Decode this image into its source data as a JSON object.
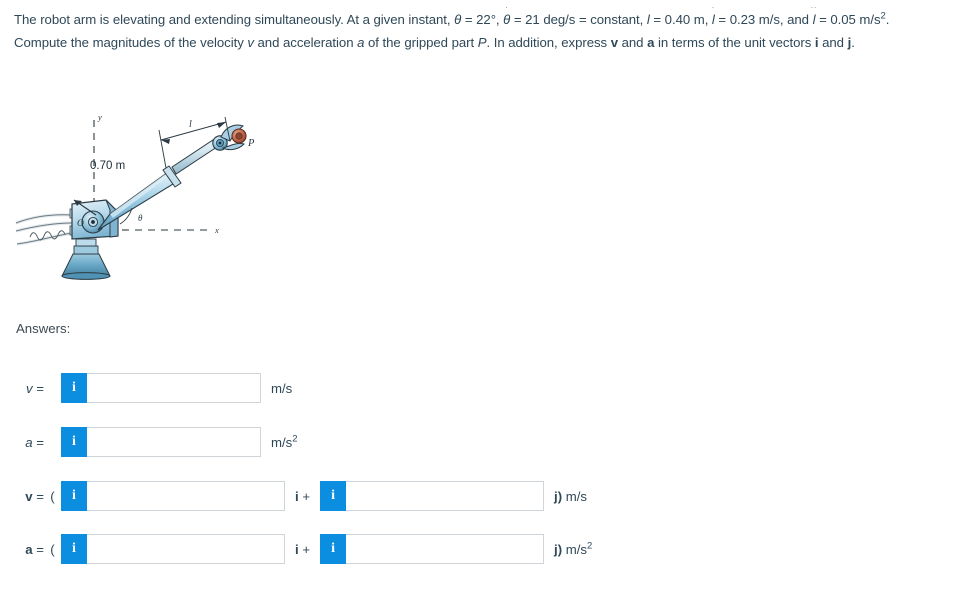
{
  "problem": {
    "line1_a": "The robot arm is elevating and extending simultaneously. At a given instant, ",
    "theta_sym": "θ",
    "eq_22": " = 22°, ",
    "thetadot_base": "θ",
    "thetadot_accent": "˙",
    "eq_21": " = 21 deg/s = constant, ",
    "l_sym": "l",
    "eq_l": " = 0.40 m, ",
    "ldot_base": "l",
    "ldot_accent": "˙",
    "eq_ldot": " = 0.23 m/s, and ",
    "lddot_base": "l",
    "lddot_accent": "˙˙",
    "eq_lddot": " = 0.05 m/s",
    "lddot_exp": "2",
    "line2_tail": ". Compute the magnitudes of the velocity ",
    "v_it": "v",
    "and_accel": " and acceleration ",
    "a_it": "a",
    "of_gripped": " of the gripped part ",
    "P_it": "P",
    "in_addition": ". In addition, express ",
    "v_bold": "v",
    "and_txt": " and ",
    "a_bold": "a",
    "in_terms": " in terms of the unit vectors ",
    "i_bold": "i",
    "and_txt2": " and ",
    "j_bold": "j",
    "period": "."
  },
  "figure": {
    "dimension_label": "0.70 m",
    "length_label": "l",
    "angle_label": "θ",
    "origin_label": "O",
    "point_label": "P",
    "x_axis_label": "x",
    "y_axis_label": "y",
    "colors": {
      "arm_light": "#cfe4f0",
      "arm_mid": "#8fc2dd",
      "arm_dark": "#5a9cc0",
      "base_dark": "#4f92b4",
      "part_red": "#c0654a",
      "outline": "#2b3a42"
    }
  },
  "answers": {
    "heading": "Answers:",
    "rows": [
      {
        "name": "velocity-magnitude",
        "label": "v",
        "label_bold": false,
        "open_paren": "",
        "value": "",
        "placeholder": "",
        "info": "i",
        "mid": "",
        "value2": null,
        "unit": "m/s",
        "unit_exp": "",
        "unit_prefix": ""
      },
      {
        "name": "acceleration-magnitude",
        "label": "a",
        "label_bold": false,
        "open_paren": "",
        "value": "",
        "placeholder": "",
        "info": "i",
        "mid": "",
        "value2": null,
        "unit": "m/s",
        "unit_exp": "2",
        "unit_prefix": ""
      },
      {
        "name": "velocity-vector",
        "label": "v",
        "label_bold": true,
        "open_paren": "(",
        "value": "",
        "placeholder": "",
        "info": "i",
        "mid_i": "i",
        "mid_plus": " +",
        "value2": "",
        "unit": " m/s",
        "unit_exp": "",
        "unit_prefix": "j)"
      },
      {
        "name": "acceleration-vector",
        "label": "a",
        "label_bold": true,
        "open_paren": "(",
        "value": "",
        "placeholder": "",
        "info": "i",
        "mid_i": "i",
        "mid_plus": " +",
        "value2": "",
        "unit": " m/s",
        "unit_exp": "2",
        "unit_prefix": "j)"
      }
    ],
    "equals": "=",
    "info_glyph": "i",
    "accent_blue": "#0b8ee0"
  }
}
